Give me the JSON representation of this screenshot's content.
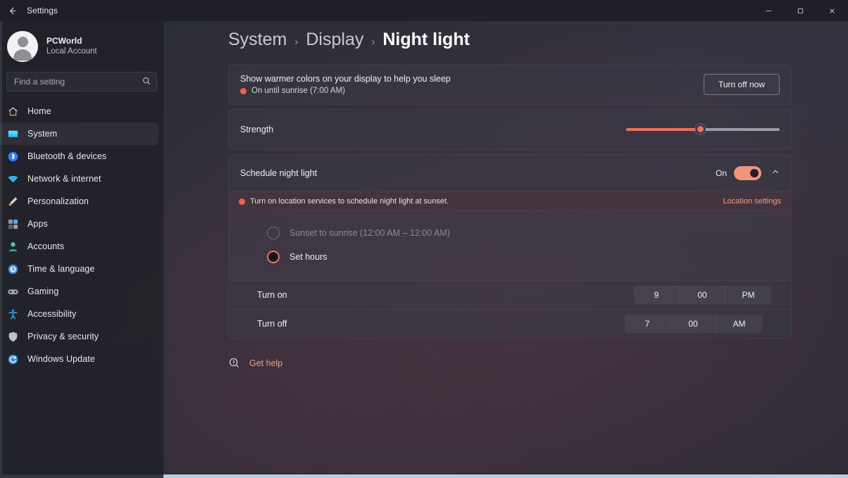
{
  "titlebar": {
    "back_icon": "back-arrow-icon",
    "title": "Settings",
    "minimize_label": "–",
    "maximize_label": "□",
    "close_label": "×"
  },
  "sidebar": {
    "account": {
      "name": "PCWorld",
      "subtitle": "Local Account",
      "avatar_icon": "person-avatar-icon"
    },
    "search": {
      "placeholder": "Find a setting",
      "value": "",
      "icon": "search-icon"
    },
    "items": [
      {
        "label": "Home",
        "icon": "home-icon",
        "selected": false
      },
      {
        "label": "System",
        "icon": "system-monitor-icon",
        "selected": true
      },
      {
        "label": "Bluetooth & devices",
        "icon": "bluetooth-icon",
        "selected": false
      },
      {
        "label": "Network & internet",
        "icon": "wifi-icon",
        "selected": false
      },
      {
        "label": "Personalization",
        "icon": "paintbrush-icon",
        "selected": false
      },
      {
        "label": "Apps",
        "icon": "apps-grid-icon",
        "selected": false
      },
      {
        "label": "Accounts",
        "icon": "accounts-person-icon",
        "selected": false
      },
      {
        "label": "Time & language",
        "icon": "clock-icon",
        "selected": false
      },
      {
        "label": "Gaming",
        "icon": "gamepad-icon",
        "selected": false
      },
      {
        "label": "Accessibility",
        "icon": "accessibility-icon",
        "selected": false
      },
      {
        "label": "Privacy & security",
        "icon": "shield-icon",
        "selected": false
      },
      {
        "label": "Windows Update",
        "icon": "update-refresh-icon",
        "selected": false
      }
    ]
  },
  "breadcrumb": {
    "level1": "System",
    "sep1": "›",
    "level2": "Display",
    "sep2": "›",
    "level3": "Night light"
  },
  "night_light_card": {
    "title": "Show warmer colors on your display to help you sleep",
    "status_text": "On until sunrise (7:00 AM)",
    "status_dot_color": "#f0604a",
    "button_label": "Turn off now"
  },
  "strength_card": {
    "label": "Strength",
    "slider": {
      "value": 48,
      "min": 0,
      "max": 100,
      "fill_color": "#f0705c",
      "track_color": "#9a9aa6"
    }
  },
  "schedule_card": {
    "label": "Schedule night light",
    "toggle_state_label": "On",
    "toggle_on": true,
    "toggle_color": "#f2937c",
    "expand_icon": "chevron-up-icon",
    "warning": {
      "dot_color": "#f0604a",
      "text": "Turn on location services to schedule night light at sunset.",
      "link_label": "Location settings",
      "link_color": "#f0a080"
    },
    "options": [
      {
        "label": "Sunset to sunrise (12:00 AM – 12:00 AM)",
        "selected": false,
        "disabled": true
      },
      {
        "label": "Set hours",
        "selected": true,
        "disabled": false
      }
    ],
    "times": [
      {
        "label": "Turn on",
        "hour": "9",
        "minute": "00",
        "meridiem": "PM"
      },
      {
        "label": "Turn off",
        "hour": "7",
        "minute": "00",
        "meridiem": "AM"
      }
    ]
  },
  "get_help": {
    "icon": "help-question-icon",
    "label": "Get help"
  }
}
